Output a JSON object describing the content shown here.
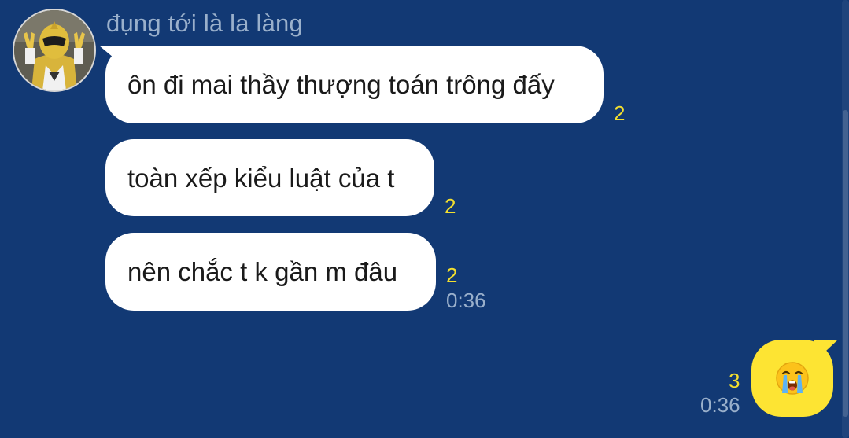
{
  "sender": {
    "name": "đụng tới là la làng"
  },
  "messages": [
    {
      "text": "ôn đi mai thầy thượng toán trông đấy",
      "read_count": "2",
      "time": ""
    },
    {
      "text": "toàn xếp kiểu luật của t",
      "read_count": "2",
      "time": ""
    },
    {
      "text": "nên chắc t k gần m đâu",
      "read_count": "2",
      "time": "0:36"
    }
  ],
  "my_message": {
    "emoji": "crying-face",
    "read_count": "3",
    "time": "0:36"
  },
  "colors": {
    "background": "#123974",
    "incoming_bubble": "#ffffff",
    "outgoing_bubble": "#fde433",
    "read_count": "#f3df2f",
    "meta_text": "#9ab0cb"
  }
}
